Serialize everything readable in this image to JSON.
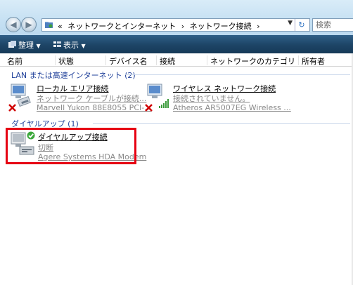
{
  "window": {
    "back_label": "◀",
    "forward_label": "▶",
    "breadcrumb": [
      "«",
      "ネットワークとインターネット",
      "›",
      "ネットワーク接続",
      "›"
    ],
    "search_placeholder": "検索"
  },
  "toolbar": {
    "organize_label": "整理",
    "view_label": "表示"
  },
  "columns": [
    "名前",
    "状態",
    "デバイス名",
    "接続",
    "ネットワークのカテゴリ",
    "所有者"
  ],
  "groups": [
    {
      "title": "LAN または高速インターネット (2)",
      "items": [
        {
          "name": "ローカル エリア接続",
          "status": "ネットワーク ケーブルが接続...",
          "device": "Marvell Yukon 88E8055 PCI-..."
        },
        {
          "name": "ワイヤレス ネットワーク接続",
          "status": "接続されていません。",
          "device": "Atheros AR5007EG Wireless ..."
        }
      ]
    },
    {
      "title": "ダイヤルアップ (1)",
      "items": [
        {
          "name": "ダイヤルアップ接続",
          "status": "切断",
          "device": "Agere Systems HDA Modem"
        }
      ]
    }
  ],
  "colors": {
    "highlight": "#e60012",
    "group_text": "#1e3f99",
    "toolbar": "#1d4466"
  },
  "icons": [
    "folder-icon",
    "refresh-icon",
    "organize-icon",
    "view-icon",
    "network-adapter-icon",
    "disconnected-x-icon",
    "wireless-signal-icon",
    "dialup-modem-icon",
    "check-icon"
  ]
}
